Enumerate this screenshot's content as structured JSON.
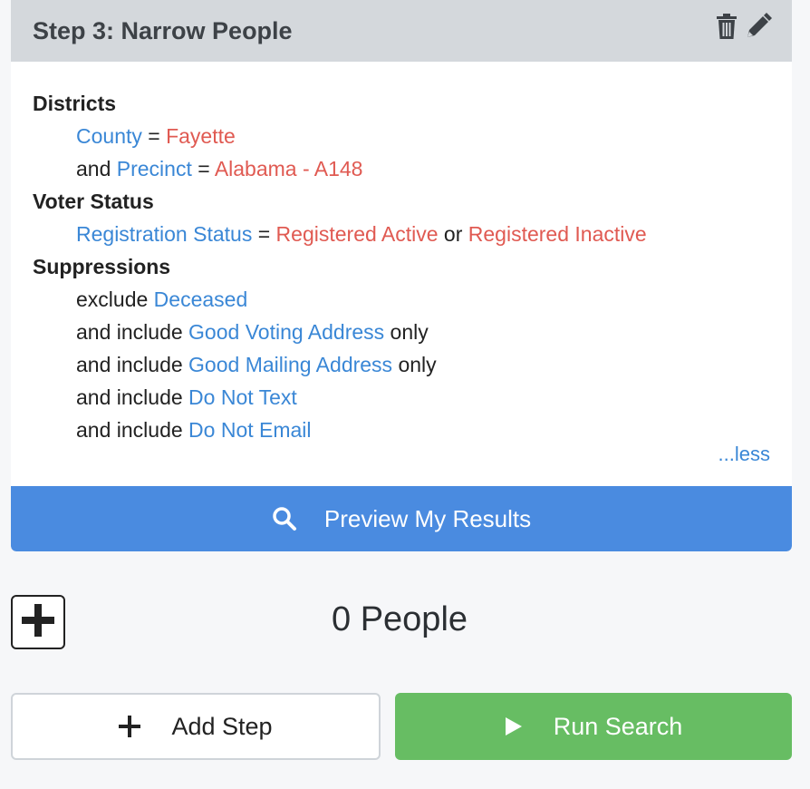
{
  "card": {
    "title": "Step 3: Narrow People",
    "icons": [
      "trash-icon",
      "pencil-icon"
    ]
  },
  "districts": {
    "heading": "Districts",
    "rows": [
      {
        "prefix": "",
        "field": "County",
        "op": "=",
        "value": "Fayette"
      },
      {
        "prefix": "and",
        "field": "Precinct",
        "op": "=",
        "value": "Alabama - A148"
      }
    ]
  },
  "voter_status": {
    "heading": "Voter Status",
    "field": "Registration Status",
    "op": "=",
    "value1": "Registered Active",
    "joiner": "or",
    "value2": "Registered Inactive"
  },
  "suppressions": {
    "heading": "Suppressions",
    "rows": [
      {
        "prefix": "exclude",
        "item": "Deceased",
        "suffix": ""
      },
      {
        "prefix": "and include",
        "item": "Good Voting Address",
        "suffix": "only"
      },
      {
        "prefix": "and include",
        "item": "Good Mailing Address",
        "suffix": "only"
      },
      {
        "prefix": "and include",
        "item": "Do Not Text",
        "suffix": ""
      },
      {
        "prefix": "and include",
        "item": "Do Not Email",
        "suffix": ""
      }
    ]
  },
  "less_link": "...less",
  "preview_button": "Preview My Results",
  "people_count": "0 People",
  "add_step_button": "Add Step",
  "run_search_button": "Run Search",
  "colors": {
    "link": "#3a87d6",
    "value": "#e05a52",
    "preview": "#4a8be0",
    "run": "#67bd63",
    "header": "#d4d8dc"
  }
}
